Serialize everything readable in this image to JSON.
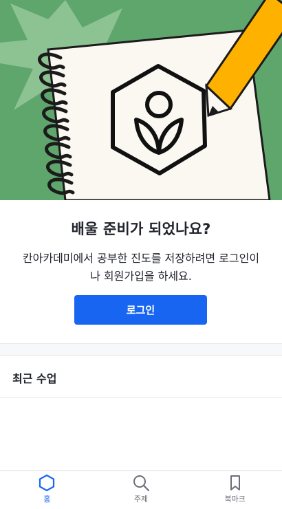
{
  "welcome": {
    "title": "배울 준비가 되었나요?",
    "body": "칸아카데미에서 공부한 진도를 저장하려면 로그인이\n나 회원가입을 하세요.",
    "login_label": "로그인"
  },
  "recent": {
    "title": "최근 수업"
  },
  "tabs": [
    {
      "label": "홈",
      "icon": "home-hexagon-icon",
      "active": true
    },
    {
      "label": "주제",
      "icon": "search-icon",
      "active": false
    },
    {
      "label": "북마크",
      "icon": "bookmark-icon",
      "active": false
    }
  ],
  "colors": {
    "accent": "#1865f2",
    "hero_green": "#5fa66c",
    "hero_star": "#8dc392",
    "pencil": "#ffb100",
    "text": "#21242c",
    "muted": "#6b6e76"
  }
}
